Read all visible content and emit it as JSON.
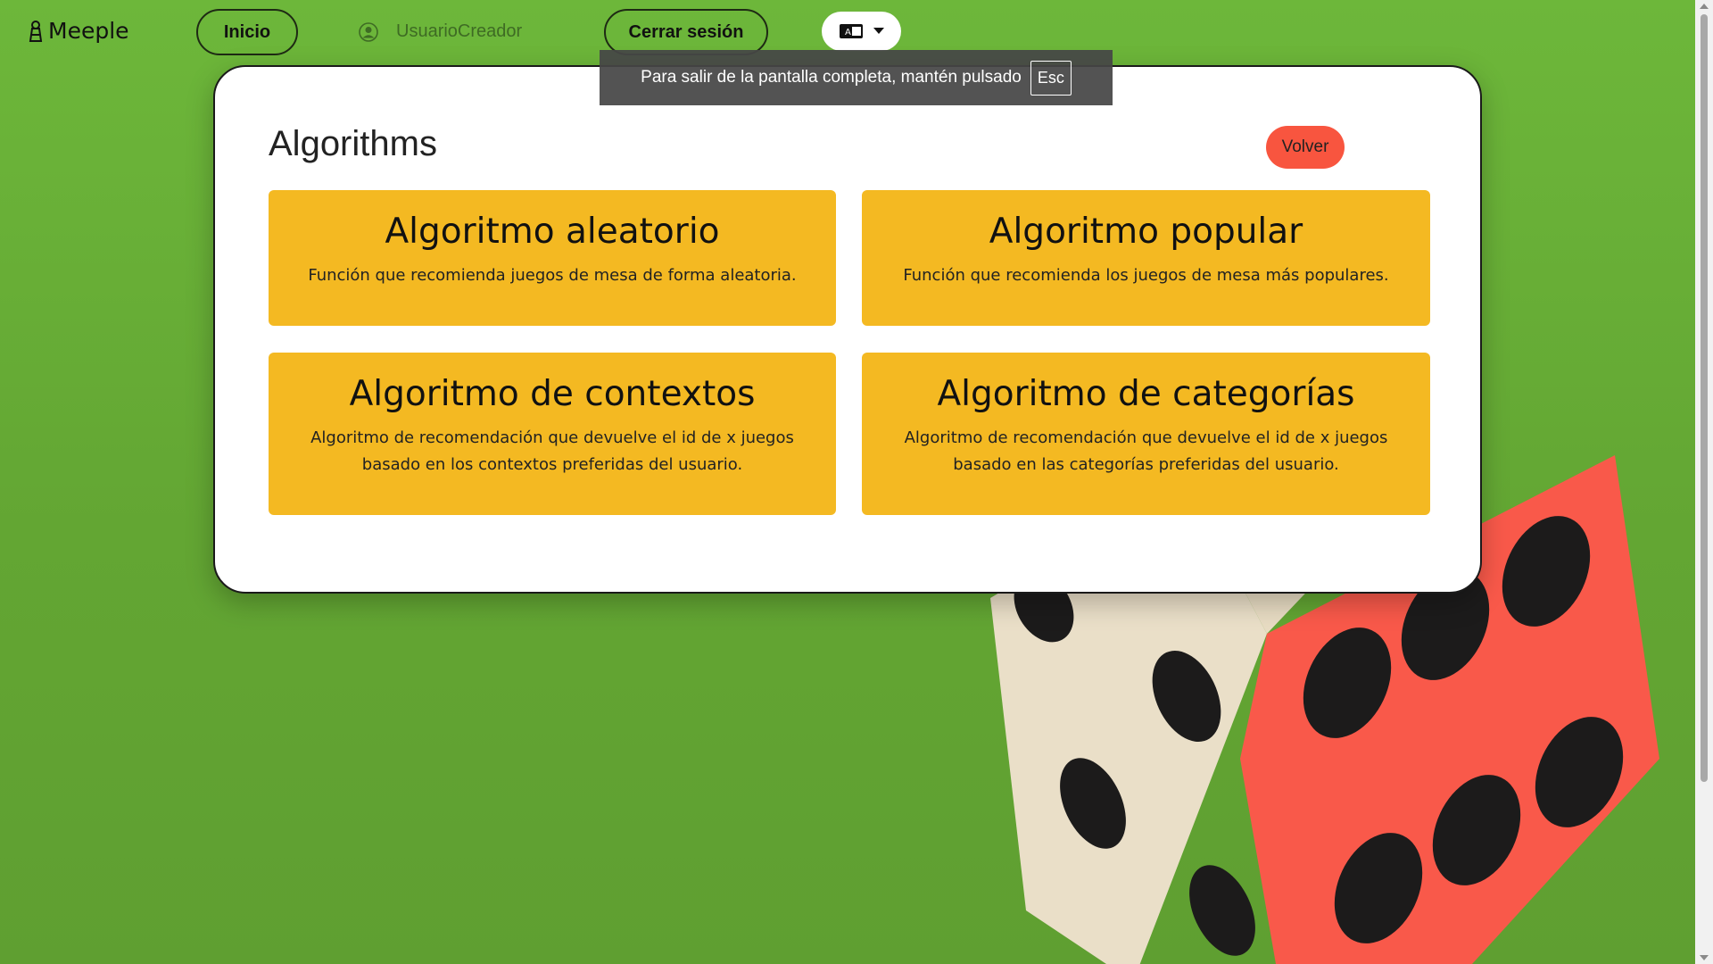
{
  "nav": {
    "brand": "Meeple",
    "home": "Inicio",
    "username": "UsuarioCreador",
    "logout": "Cerrar sesión"
  },
  "fullscreen_notice": {
    "text": "Para salir de la pantalla completa, mantén pulsado",
    "key": "Esc"
  },
  "page": {
    "title": "Algorithms",
    "back": "Volver"
  },
  "algorithms": [
    {
      "title": "Algoritmo aleatorio",
      "description": "Función que recomienda juegos de mesa de forma aleatoria."
    },
    {
      "title": "Algoritmo popular",
      "description": "Función que recomienda los juegos de mesa más populares."
    },
    {
      "title": "Algoritmo de contextos",
      "description": "Algoritmo de recomendación que devuelve el id de x juegos basado en los contextos preferidas del usuario."
    },
    {
      "title": "Algoritmo de categorías",
      "description": "Algoritmo de recomendación que devuelve el id de x juegos basado en las categorías preferidas del usuario."
    }
  ],
  "colors": {
    "background": "#66ad36",
    "card": "#ffffff",
    "algorithm_card": "#f4b922",
    "back_button": "#f8553f",
    "dice_red": "#f9594a",
    "dice_cream": "#eadfc8"
  },
  "icons": [
    "meeple-icon",
    "user-icon",
    "language-icon",
    "caret-down-icon",
    "dice-illustration"
  ]
}
